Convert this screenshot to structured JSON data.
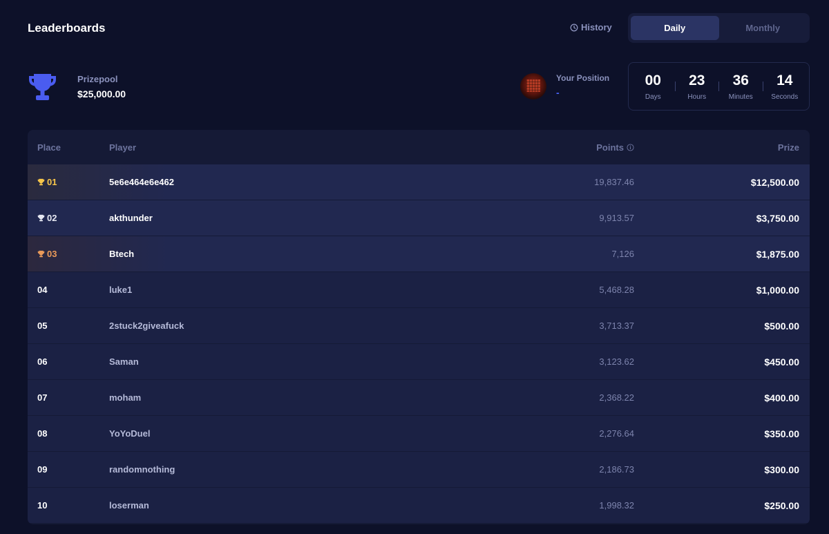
{
  "header": {
    "title": "Leaderboards",
    "history_label": "History",
    "tabs": [
      {
        "label": "Daily",
        "active": true
      },
      {
        "label": "Monthly",
        "active": false
      }
    ]
  },
  "prizepool": {
    "label": "Prizepool",
    "value": "$25,000.00",
    "icon": "trophy-icon"
  },
  "your_position": {
    "label": "Your Position",
    "value": "-"
  },
  "countdown": [
    {
      "value": "00",
      "label": "Days"
    },
    {
      "value": "23",
      "label": "Hours"
    },
    {
      "value": "36",
      "label": "Minutes"
    },
    {
      "value": "14",
      "label": "Seconds"
    }
  ],
  "table": {
    "columns": {
      "place": "Place",
      "player": "Player",
      "points": "Points",
      "prize": "Prize"
    },
    "rows": [
      {
        "place": "01",
        "player": "5e6e464e6e462",
        "points": "19,837.46",
        "prize": "$12,500.00",
        "medal": "gold"
      },
      {
        "place": "02",
        "player": "akthunder",
        "points": "9,913.57",
        "prize": "$3,750.00",
        "medal": "silver"
      },
      {
        "place": "03",
        "player": "Btech",
        "points": "7,126",
        "prize": "$1,875.00",
        "medal": "bronze"
      },
      {
        "place": "04",
        "player": "luke1",
        "points": "5,468.28",
        "prize": "$1,000.00",
        "medal": ""
      },
      {
        "place": "05",
        "player": "2stuck2giveafuck",
        "points": "3,713.37",
        "prize": "$500.00",
        "medal": ""
      },
      {
        "place": "06",
        "player": "Saman",
        "points": "3,123.62",
        "prize": "$450.00",
        "medal": ""
      },
      {
        "place": "07",
        "player": "moham",
        "points": "2,368.22",
        "prize": "$400.00",
        "medal": ""
      },
      {
        "place": "08",
        "player": "YoYoDuel",
        "points": "2,276.64",
        "prize": "$350.00",
        "medal": ""
      },
      {
        "place": "09",
        "player": "randomnothing",
        "points": "2,186.73",
        "prize": "$300.00",
        "medal": ""
      },
      {
        "place": "10",
        "player": "loserman",
        "points": "1,998.32",
        "prize": "$250.00",
        "medal": ""
      }
    ]
  },
  "colors": {
    "background": "#0d1129",
    "accent": "#4a67ff",
    "gold": "#f7c64a",
    "silver": "#e6e8f2",
    "bronze": "#ea9a5a"
  }
}
